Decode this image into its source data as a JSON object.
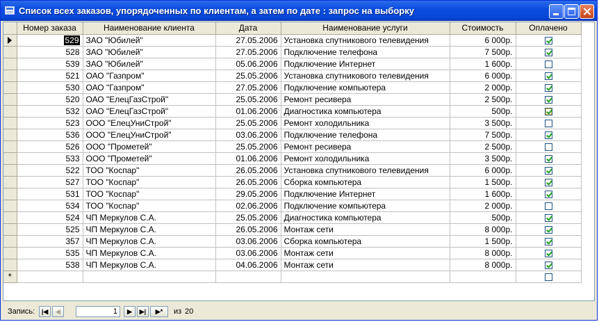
{
  "window": {
    "title": "Список всех заказов, упорядоченных по клиентам, а затем по дате : запрос на выборку"
  },
  "columns": [
    "Номер заказа",
    "Наименование клиента",
    "Дата",
    "Наименование услуги",
    "Стоимость",
    "Оплачено"
  ],
  "rows": [
    {
      "num": "529",
      "client": "ЗАО \"Юбилей\"",
      "date": "27.05.2006",
      "service": "Установка спутникового телевидения",
      "cost": "6 000р.",
      "paid": true
    },
    {
      "num": "528",
      "client": "ЗАО \"Юбилей\"",
      "date": "27.05.2006",
      "service": "Подключение телефона",
      "cost": "7 500р.",
      "paid": true
    },
    {
      "num": "539",
      "client": "ЗАО \"Юбилей\"",
      "date": "05.06.2006",
      "service": "Подключение Интернет",
      "cost": "1 600р.",
      "paid": false
    },
    {
      "num": "521",
      "client": "ОАО \"Газпром\"",
      "date": "25.05.2006",
      "service": "Установка спутникового телевидения",
      "cost": "6 000р.",
      "paid": true
    },
    {
      "num": "530",
      "client": "ОАО \"Газпром\"",
      "date": "27.05.2006",
      "service": "Подключение компьютера",
      "cost": "2 000р.",
      "paid": true
    },
    {
      "num": "520",
      "client": "ОАО \"ЕлецГазСтрой\"",
      "date": "25.05.2006",
      "service": "Ремонт ресивера",
      "cost": "2 500р.",
      "paid": true
    },
    {
      "num": "532",
      "client": "ОАО \"ЕлецГазСтрой\"",
      "date": "01.06.2006",
      "service": "Диагностика компьютера",
      "cost": "500р.",
      "paid": true
    },
    {
      "num": "523",
      "client": "ООО \"ЕлецУниСтрой\"",
      "date": "25.05.2006",
      "service": "Ремонт холодильника",
      "cost": "3 500р.",
      "paid": false
    },
    {
      "num": "536",
      "client": "ООО \"ЕлецУниСтрой\"",
      "date": "03.06.2006",
      "service": "Подключение телефона",
      "cost": "7 500р.",
      "paid": true
    },
    {
      "num": "526",
      "client": "ООО \"Прометей\"",
      "date": "25.05.2006",
      "service": "Ремонт ресивера",
      "cost": "2 500р.",
      "paid": false
    },
    {
      "num": "533",
      "client": "ООО \"Прометей\"",
      "date": "01.06.2006",
      "service": "Ремонт холодильника",
      "cost": "3 500р.",
      "paid": true
    },
    {
      "num": "522",
      "client": "ТОО \"Коспар\"",
      "date": "26.05.2006",
      "service": "Установка спутникового телевидения",
      "cost": "6 000р.",
      "paid": true
    },
    {
      "num": "527",
      "client": "ТОО \"Коспар\"",
      "date": "26.05.2006",
      "service": "Сборка компьютера",
      "cost": "1 500р.",
      "paid": true
    },
    {
      "num": "531",
      "client": "ТОО \"Коспар\"",
      "date": "29.05.2006",
      "service": "Подключение Интернет",
      "cost": "1 600р.",
      "paid": true
    },
    {
      "num": "534",
      "client": "ТОО \"Коспар\"",
      "date": "02.06.2006",
      "service": "Подключение компьютера",
      "cost": "2 000р.",
      "paid": false
    },
    {
      "num": "524",
      "client": "ЧП Меркулов С.А.",
      "date": "25.05.2006",
      "service": "Диагностика компьютера",
      "cost": "500р.",
      "paid": true
    },
    {
      "num": "525",
      "client": "ЧП Меркулов С.А.",
      "date": "26.05.2006",
      "service": "Монтаж сети",
      "cost": "8 000р.",
      "paid": true
    },
    {
      "num": "357",
      "client": "ЧП Меркулов С.А.",
      "date": "03.06.2006",
      "service": "Сборка компьютера",
      "cost": "1 500р.",
      "paid": true
    },
    {
      "num": "535",
      "client": "ЧП Меркулов С.А.",
      "date": "03.06.2006",
      "service": "Монтаж сети",
      "cost": "8 000р.",
      "paid": true
    },
    {
      "num": "538",
      "client": "ЧП Меркулов С.А.",
      "date": "04.06.2006",
      "service": "Монтаж сети",
      "cost": "8 000р.",
      "paid": true
    }
  ],
  "new_row_marker": "*",
  "nav": {
    "label": "Запись:",
    "current": "1",
    "of": "из",
    "total": "20",
    "btn_first": "|◀",
    "btn_prev": "◀",
    "btn_next": "▶",
    "btn_last": "▶|",
    "btn_new": "▶*"
  },
  "colors": {
    "titlebar": "#0a4de0",
    "check": "#21a121"
  }
}
